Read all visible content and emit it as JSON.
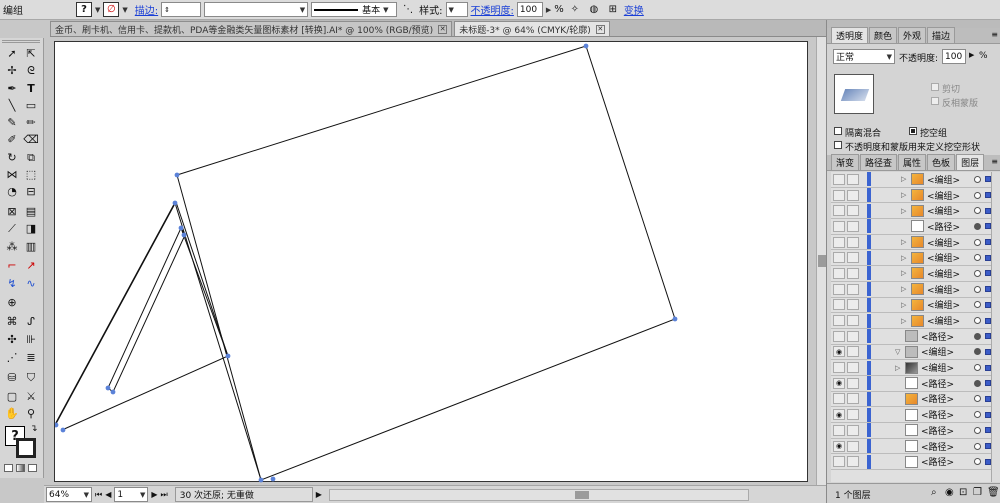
{
  "control_bar": {
    "selection_label": "编组",
    "stroke_label": "描边:",
    "stroke_profile": "基本",
    "style_label": "样式:",
    "opacity_label": "不透明度:",
    "opacity_value": "100",
    "percent": "%",
    "transform_label": "变换"
  },
  "document_tabs": [
    {
      "title": "金币、刷卡机、信用卡、提款机、PDA等金融类矢量图标素材 [转换].AI* @ 100% (RGB/预览)"
    },
    {
      "title": "未标题-3* @ 64% (CMYK/轮廓)"
    }
  ],
  "status_bar": {
    "zoom": "64%",
    "page": "1",
    "history": "30 次还原; 无重做"
  },
  "transparency_panel": {
    "tabs": [
      "透明度",
      "颜色",
      "外观",
      "描边"
    ],
    "blend_mode": "正常",
    "opacity_label": "不透明度:",
    "opacity_value": "100",
    "percent": "%",
    "clip_label": "剪切",
    "invert_mask_label": "反相蒙版",
    "isolate_blending_label": "隔离混合",
    "knockout_group_label": "挖空组",
    "opacity_mask_label": "不透明度和蒙版用来定义挖空形状"
  },
  "layers_panel": {
    "tabs": [
      "渐变",
      "路径查",
      "属性",
      "色板",
      "图层"
    ],
    "footer": "1 个图层"
  },
  "layers": [
    {
      "name": "<编组>",
      "thumb": "orange"
    },
    {
      "name": "<编组>",
      "thumb": "orange"
    },
    {
      "name": "<编组>",
      "thumb": "orange"
    },
    {
      "name": "<路径>",
      "thumb": "line"
    },
    {
      "name": "<编组>",
      "thumb": "orange"
    },
    {
      "name": "<编组>",
      "thumb": "orange"
    },
    {
      "name": "<编组>",
      "thumb": "orange"
    },
    {
      "name": "<编组>",
      "thumb": "orange"
    },
    {
      "name": "<编组>",
      "thumb": "orange"
    },
    {
      "name": "<编组>",
      "thumb": "orange"
    },
    {
      "name": "<路径>",
      "thumb": "grey"
    },
    {
      "name": "<编组>",
      "thumb": "grey"
    },
    {
      "name": "<编组>",
      "thumb": "dark"
    },
    {
      "name": "<路径>",
      "thumb": "line"
    },
    {
      "name": "<路径>",
      "thumb": "orange"
    },
    {
      "name": "<路径>",
      "thumb": "white"
    },
    {
      "name": "<路径>",
      "thumb": "white"
    },
    {
      "name": "<路径>",
      "thumb": "white"
    },
    {
      "name": "<路径>",
      "thumb": "white"
    }
  ],
  "colors": {
    "anchor": "#5b82d8",
    "layer_blue": "#3b64d1",
    "link": "#1a3fd6"
  }
}
